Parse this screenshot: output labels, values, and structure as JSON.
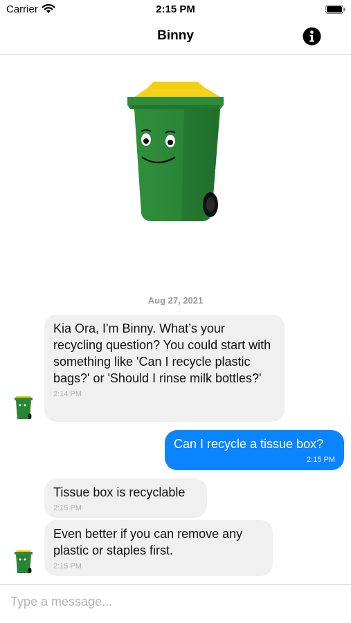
{
  "status": {
    "carrier": "Carrier",
    "time": "2:15 PM"
  },
  "nav": {
    "title": "Binny",
    "info_icon": "info-circle-icon"
  },
  "chat": {
    "date": "Aug 27, 2021",
    "messages": [
      {
        "sender": "bot",
        "text": "Kia Ora, I'm Binny. What’s your recycling question? You could start with something like 'Can I recycle plastic bags?' or 'Should I rinse milk bottles?'",
        "time": "2:14 PM"
      },
      {
        "sender": "user",
        "text": "Can I recycle a tissue box?",
        "time": "2:15 PM"
      },
      {
        "sender": "bot",
        "text": "Tissue box is recyclable",
        "time": "2:15 PM"
      },
      {
        "sender": "bot",
        "text": "Even better if you can remove any plastic or staples first.",
        "time": "2:15 PM"
      }
    ]
  },
  "composer": {
    "placeholder": "Type a message..."
  },
  "colors": {
    "outgoing": "#0a84ff",
    "incoming": "#f0f0f0",
    "bin_green": "#2e8b3a",
    "bin_lid": "#f2cf12"
  }
}
